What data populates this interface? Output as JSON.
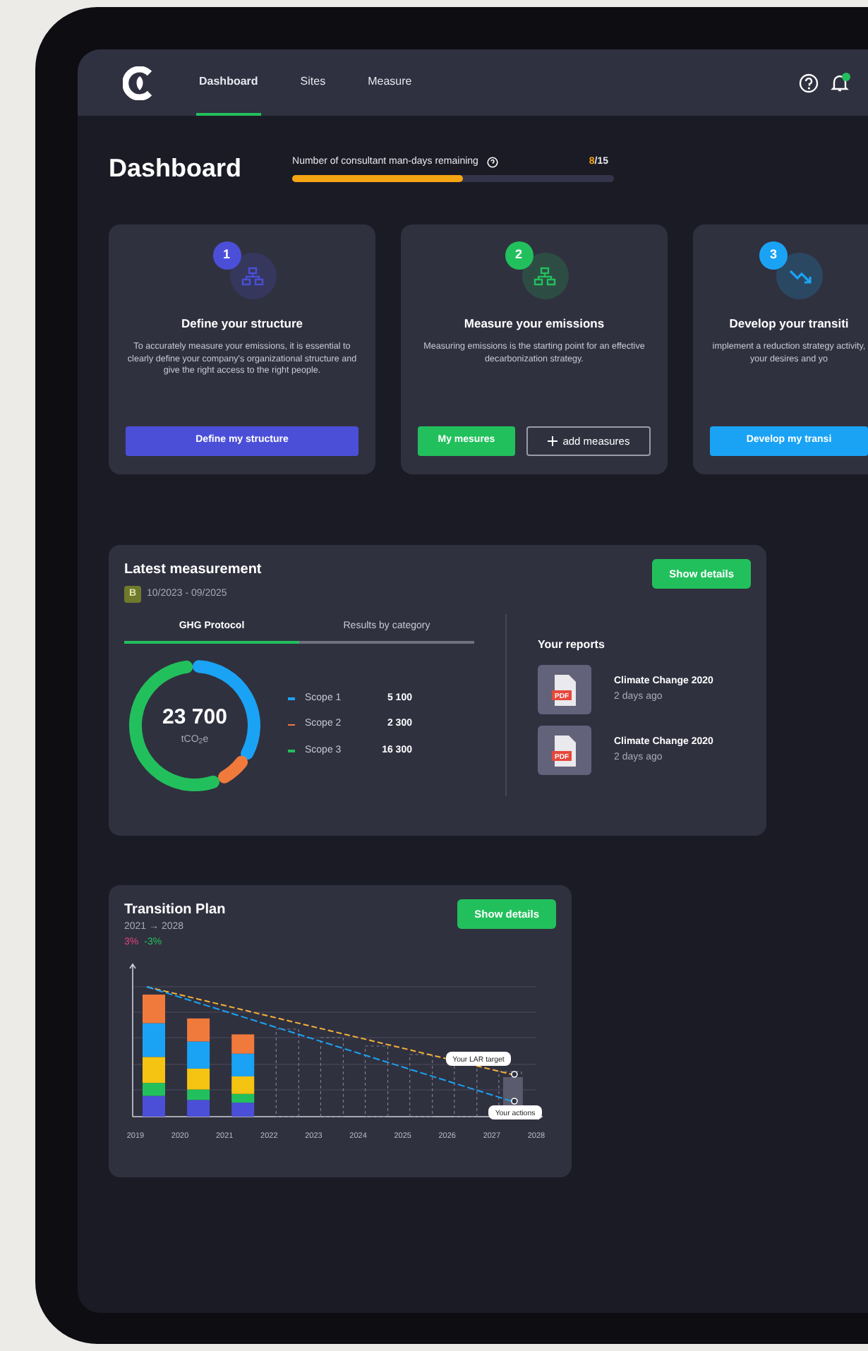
{
  "nav": {
    "tabs": [
      {
        "label": "Dashboard",
        "selected": true
      },
      {
        "label": "Sites",
        "selected": false
      },
      {
        "label": "Measure",
        "selected": false
      }
    ],
    "unread_notifications": true
  },
  "page_title": "Dashboard",
  "consultant_days": {
    "label": "Number of consultant man-days remaining",
    "used": "8",
    "total": "/15",
    "level": 0.53
  },
  "steps": [
    {
      "number": "1",
      "color": "#4b4fd8",
      "title": "Define your structure",
      "text": "To accurately measure your emissions, it is essential to clearly define your company's organizational structure and give the right access to the right people.",
      "buttons": [
        {
          "kind": "solid",
          "label": "Define my structure"
        }
      ]
    },
    {
      "number": "2",
      "color": "#22c05c",
      "title": "Measure your emissions",
      "text": "Measuring emissions is the starting point for an effective decarbonization strategy.",
      "buttons": [
        {
          "kind": "solid",
          "label": "My mesures"
        },
        {
          "kind": "outline",
          "label": "add measures"
        }
      ]
    },
    {
      "number": "3",
      "color": "#1aa3f5",
      "title": "Develop your transiti",
      "text": "implement a reduction strategy activity, your desires and yo",
      "buttons": [
        {
          "kind": "solid",
          "label": "Develop my transi"
        }
      ]
    }
  ],
  "latest_measurement": {
    "title": "Latest measurement",
    "grade": "B",
    "period": "10/2023 - 09/2025",
    "button": "Show details",
    "tabs": [
      {
        "label": "GHG Protocol",
        "selected": true
      },
      {
        "label": "Results by category",
        "selected": false
      }
    ],
    "total": "23 700",
    "unit": "tCO$_{2}$e",
    "legend": [
      {
        "label": "Scope 1",
        "value": "5 100",
        "color": "#1aa3f5"
      },
      {
        "label": "Scope 2",
        "value": "2 300",
        "color": "#f07a3c"
      },
      {
        "label": "Scope 3",
        "value": "16 300",
        "color": "#22c05c"
      }
    ],
    "reports_title": "Your reports",
    "reports": [
      {
        "title": "Climate Change 2020",
        "time": "2 days ago",
        "file_type": "PDF"
      },
      {
        "title": "Climate Change 2020",
        "time": "2 days ago",
        "file_type": "PDF"
      }
    ]
  },
  "transition_plan": {
    "title": "Transition Plan",
    "period": "2021 → 2028",
    "changes": [
      {
        "text": "3%",
        "color": "#e0447a"
      },
      {
        "text": "-3%",
        "color": "#22c05c"
      }
    ],
    "button": "Show details",
    "target_label": "Your LAR target",
    "actions_label": "Your actions",
    "years": [
      "2019",
      "2020",
      "2021",
      "2022",
      "2023",
      "2024",
      "2025",
      "2026",
      "2027",
      "2028"
    ]
  }
}
